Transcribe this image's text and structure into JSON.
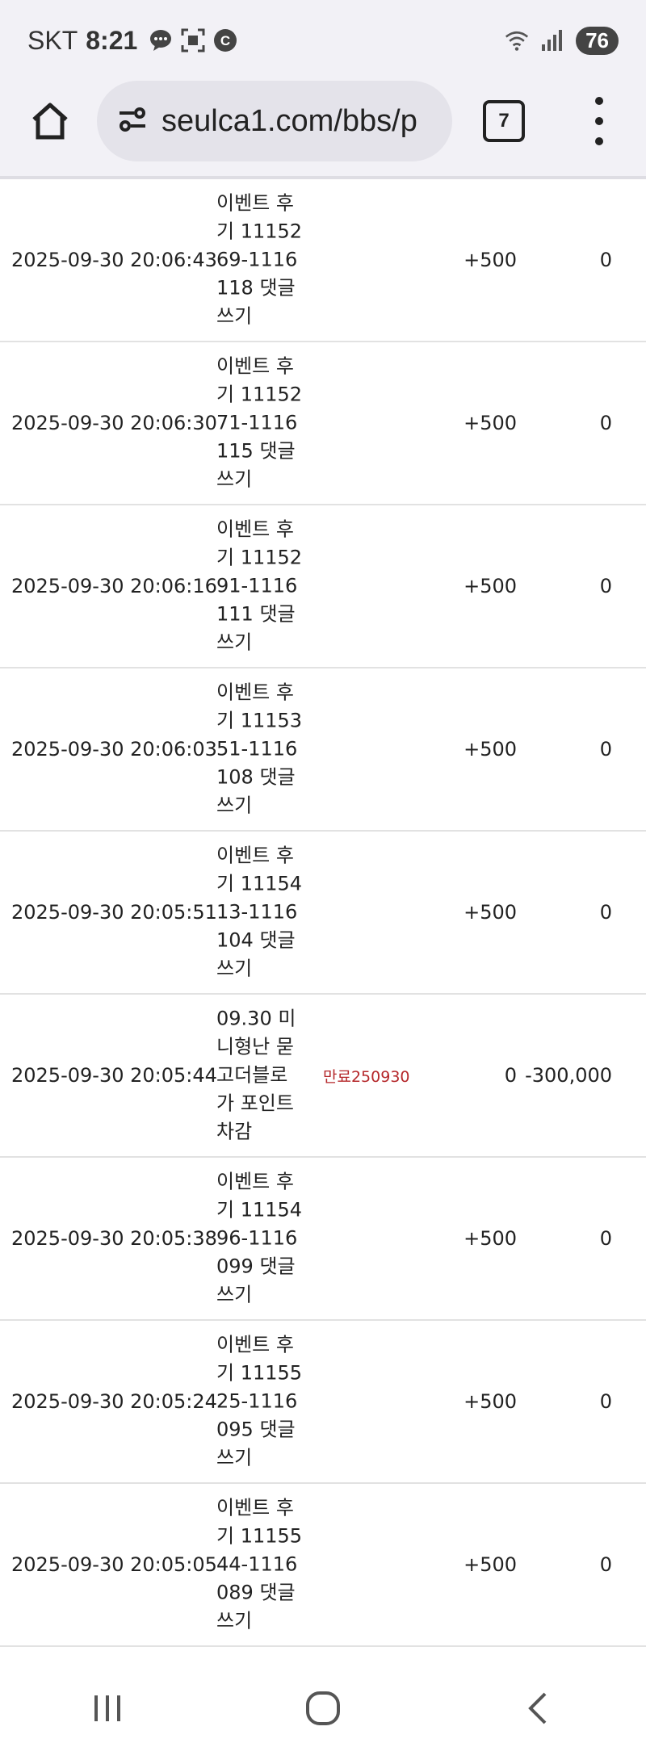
{
  "status_bar": {
    "carrier": "SKT",
    "time": "8:21",
    "battery": "76",
    "icons": [
      "chat-bubble-icon",
      "screenshot-icon",
      "c-app-icon",
      "wifi-icon",
      "signal-icon"
    ]
  },
  "browser": {
    "url": "seulca1.com/bbs/p",
    "tab_count": "7",
    "icons": [
      "home-icon",
      "site-settings-icon",
      "menu-dots-icon"
    ]
  },
  "rows": [
    {
      "date": "2025-09-30 20:06:43",
      "desc": "이벤트 후기 1115269-1116118 댓글쓰기",
      "note": "",
      "plus": "+500",
      "minus": "0"
    },
    {
      "date": "2025-09-30 20:06:30",
      "desc": "이벤트 후기 1115271-1116115 댓글쓰기",
      "note": "",
      "plus": "+500",
      "minus": "0"
    },
    {
      "date": "2025-09-30 20:06:16",
      "desc": "이벤트 후기 1115291-1116111 댓글쓰기",
      "note": "",
      "plus": "+500",
      "minus": "0"
    },
    {
      "date": "2025-09-30 20:06:03",
      "desc": "이벤트 후기 1115351-1116108 댓글쓰기",
      "note": "",
      "plus": "+500",
      "minus": "0"
    },
    {
      "date": "2025-09-30 20:05:51",
      "desc": "이벤트 후기 1115413-1116104 댓글쓰기",
      "note": "",
      "plus": "+500",
      "minus": "0"
    },
    {
      "date": "2025-09-30 20:05:44",
      "desc": "09.30 미니형난 묻고더블로가 포인트 차감",
      "note": "만료250930",
      "plus": "0",
      "minus": "-300,000"
    },
    {
      "date": "2025-09-30 20:05:38",
      "desc": "이벤트 후기 1115496-1116099 댓글쓰기",
      "note": "",
      "plus": "+500",
      "minus": "0"
    },
    {
      "date": "2025-09-30 20:05:24",
      "desc": "이벤트 후기 1115525-1116095 댓글쓰기",
      "note": "",
      "plus": "+500",
      "minus": "0"
    },
    {
      "date": "2025-09-30 20:05:05",
      "desc": "이벤트 후기 1115544-1116089 댓글쓰기",
      "note": "",
      "plus": "+500",
      "minus": "0"
    }
  ],
  "nav": {
    "icons": [
      "recent-apps-icon",
      "home-circle-icon",
      "back-icon"
    ]
  },
  "colors": {
    "chrome_bg": "#f2f1f6",
    "url_bg": "#e4e3ea",
    "expired_note": "#b5282b"
  }
}
